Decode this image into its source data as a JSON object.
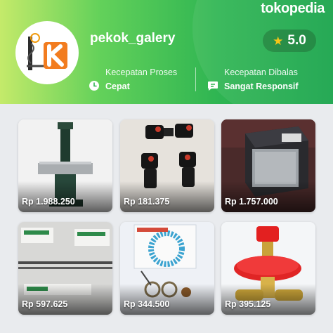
{
  "brand": {
    "label": "tokopedia"
  },
  "shop": {
    "name": "pekok_galery",
    "rating": "5.0",
    "logo_letter": "K"
  },
  "stats": [
    {
      "label": "Kecepatan Proses",
      "value": "Cepat",
      "icon": "clock-icon"
    },
    {
      "label": "Kecepatan Dibalas",
      "value": "Sangat Responsif",
      "icon": "chat-bubble-icon"
    }
  ],
  "products": [
    {
      "price": "Rp 1.988.250",
      "image": "band-saw-machine"
    },
    {
      "price": "Rp 181.375",
      "image": "water-pumps"
    },
    {
      "price": "Rp 1.757.000",
      "image": "inverter-box"
    },
    {
      "price": "Rp 597.625",
      "image": "metal-rods"
    },
    {
      "price": "Rp 344.500",
      "image": "gasket-kit"
    },
    {
      "price": "Rp 395.125",
      "image": "gas-regulator"
    }
  ],
  "colors": {
    "accent": "#16a34a",
    "star": "#f5c518"
  }
}
